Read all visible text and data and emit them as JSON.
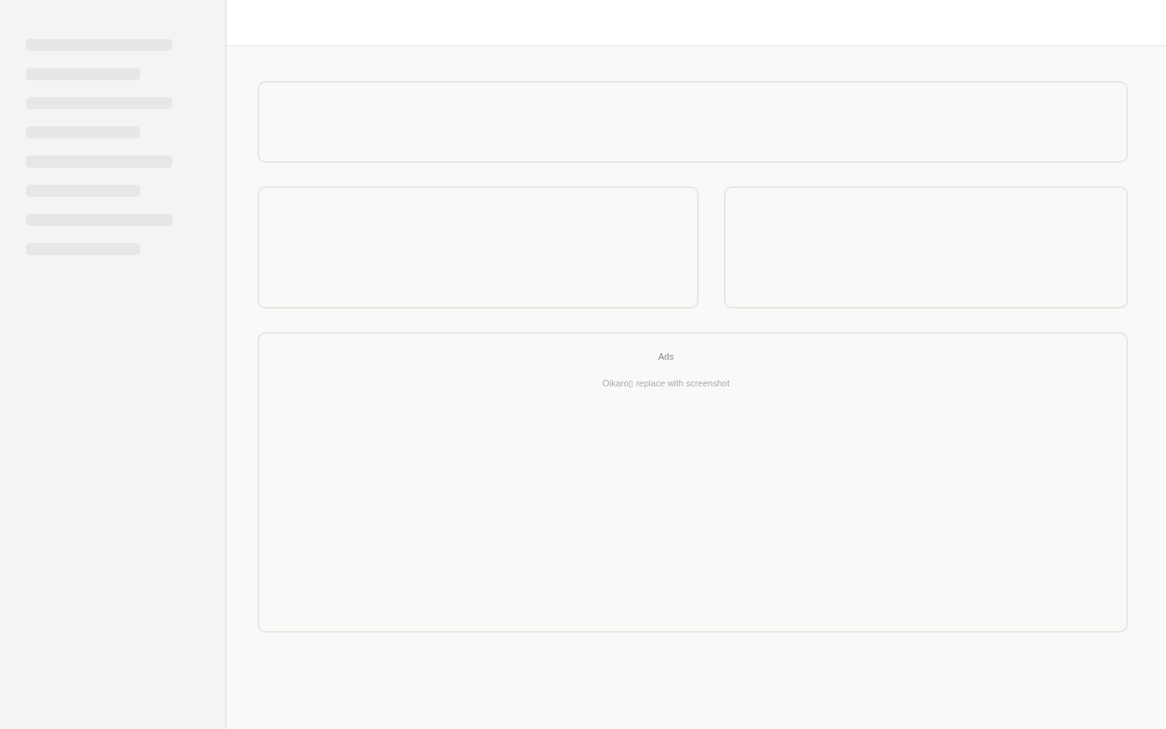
{
  "sidebar": {
    "loading_lines": [
      {
        "kind": "long"
      },
      {
        "kind": "short"
      },
      {
        "kind": "long"
      },
      {
        "kind": "short"
      },
      {
        "kind": "long"
      },
      {
        "kind": "short"
      },
      {
        "kind": "long"
      },
      {
        "kind": "short"
      }
    ]
  },
  "ads_panel": {
    "title": "Ads",
    "note": "Oikaro▯ replace with screenshot"
  }
}
